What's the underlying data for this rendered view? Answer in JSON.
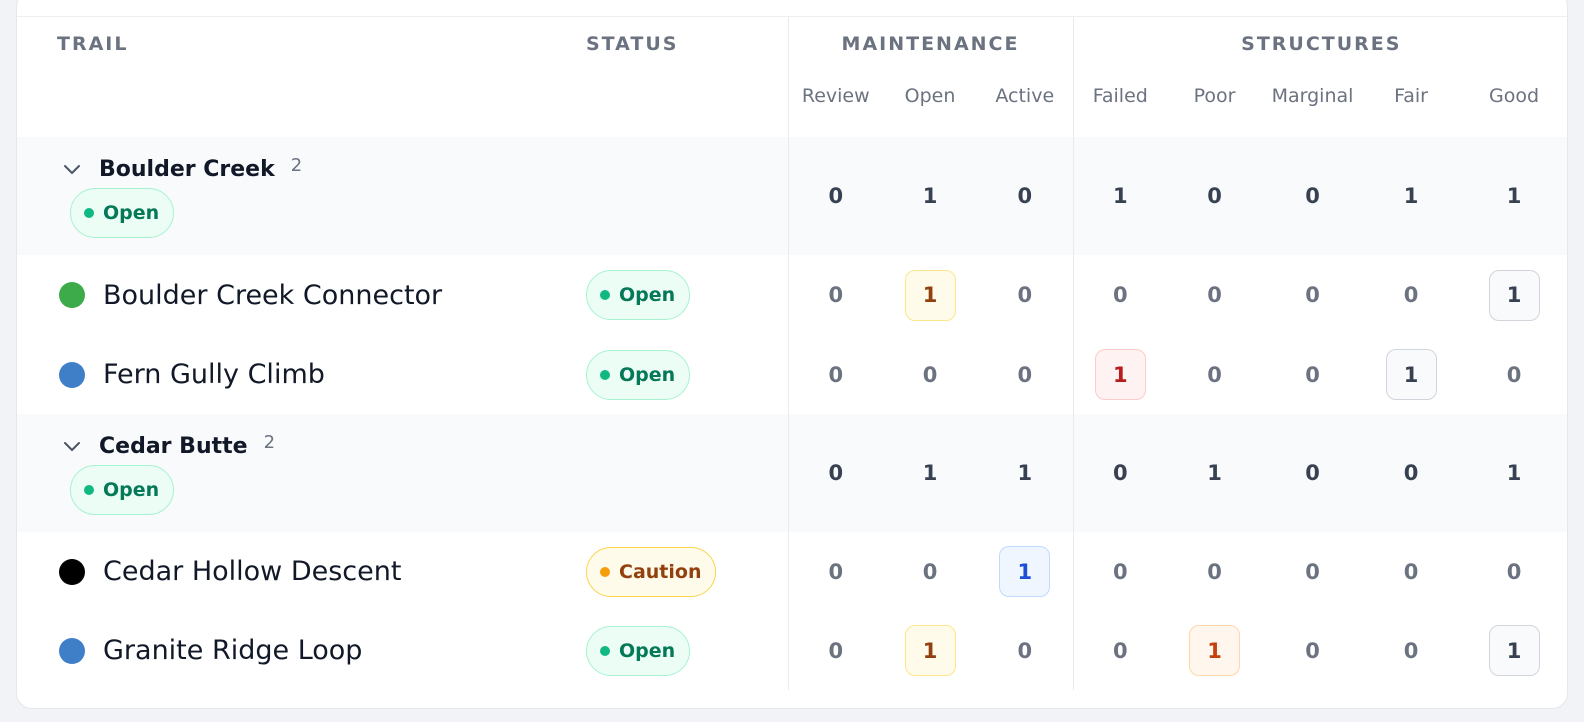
{
  "headers": {
    "trail": "TRAIL",
    "status": "STATUS",
    "maintenance": "MAINTENANCE",
    "structures": "STRUCTURES",
    "maintenance_cols": [
      "Review",
      "Open",
      "Active"
    ],
    "structures_cols": [
      "Failed",
      "Poor",
      "Marginal",
      "Fair",
      "Good"
    ]
  },
  "colors": {
    "open": "#10b981",
    "caution": "#f59e0b",
    "dot_green": "#3dab4a",
    "dot_blue": "#3f7fc8",
    "dot_black": "#000000"
  },
  "groups": [
    {
      "name": "Boulder Creek",
      "count": "2",
      "status": "Open",
      "totals": [
        "0",
        "1",
        "0",
        "1",
        "0",
        "0",
        "1",
        "1"
      ],
      "trails": [
        {
          "name": "Boulder Creek Connector",
          "difficulty_color": "#3dab4a",
          "status": "Open",
          "values": [
            "0",
            "1",
            "0",
            "0",
            "0",
            "0",
            "0",
            "1"
          ]
        },
        {
          "name": "Fern Gully Climb",
          "difficulty_color": "#3f7fc8",
          "status": "Open",
          "values": [
            "0",
            "0",
            "0",
            "1",
            "0",
            "0",
            "1",
            "0"
          ]
        }
      ]
    },
    {
      "name": "Cedar Butte",
      "count": "2",
      "status": "Open",
      "totals": [
        "0",
        "1",
        "1",
        "0",
        "1",
        "0",
        "0",
        "1"
      ],
      "trails": [
        {
          "name": "Cedar Hollow Descent",
          "difficulty_color": "#000000",
          "status": "Caution",
          "values": [
            "0",
            "0",
            "1",
            "0",
            "0",
            "0",
            "0",
            "0"
          ]
        },
        {
          "name": "Granite Ridge Loop",
          "difficulty_color": "#3f7fc8",
          "status": "Open",
          "values": [
            "0",
            "1",
            "0",
            "0",
            "1",
            "0",
            "0",
            "1"
          ]
        }
      ]
    }
  ]
}
